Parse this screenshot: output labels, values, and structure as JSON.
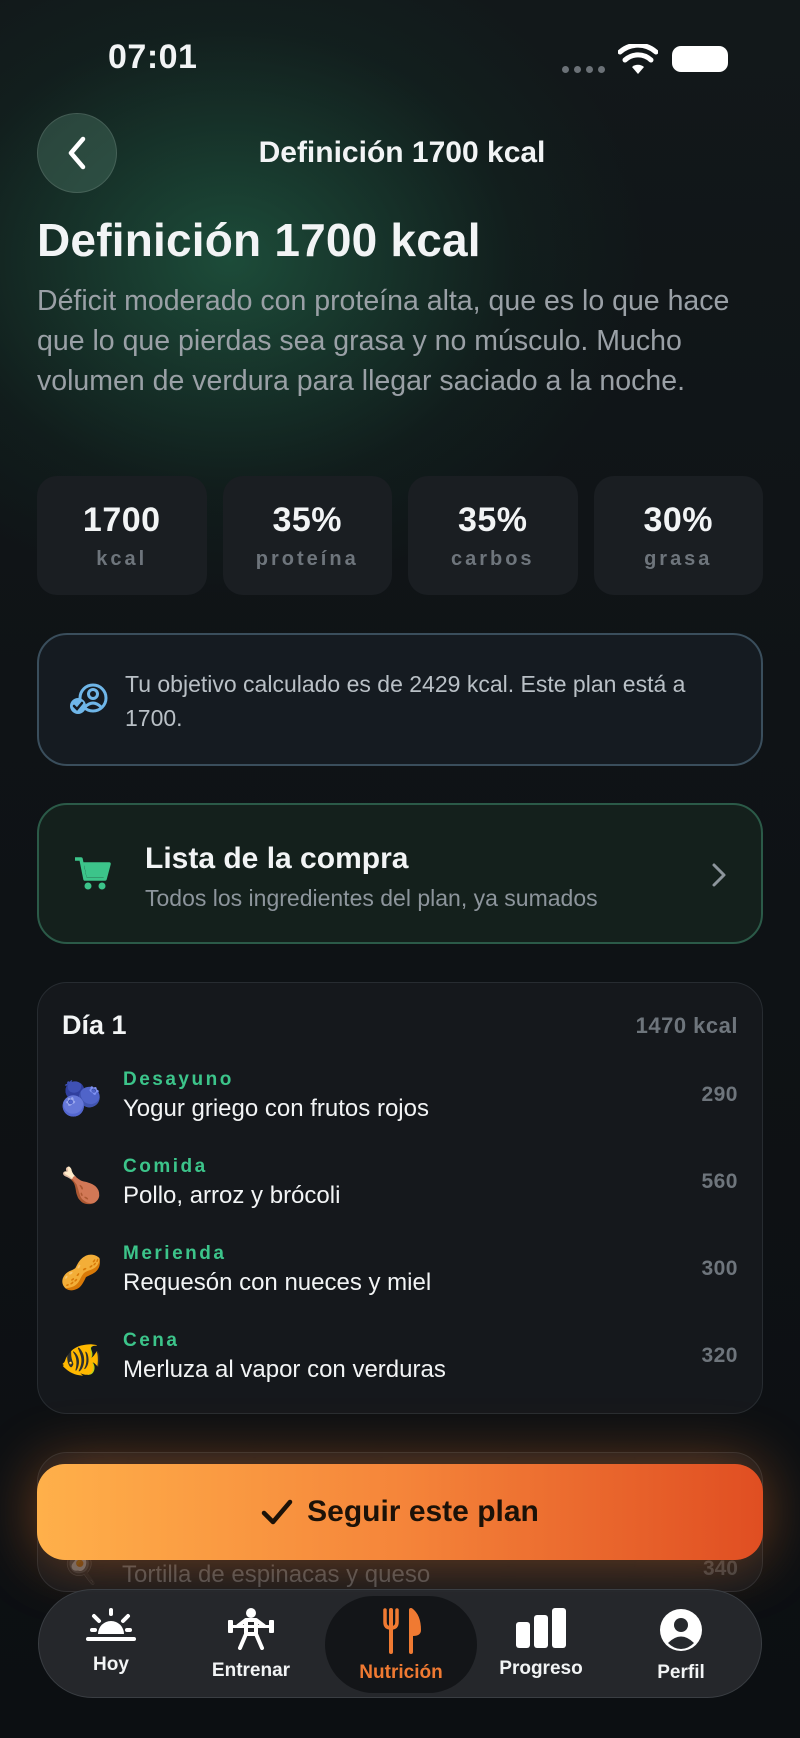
{
  "status_bar": {
    "time": "07:01"
  },
  "header": {
    "title": "Definición 1700 kcal"
  },
  "plan": {
    "title": "Definición 1700 kcal",
    "description": "Déficit moderado con proteína alta, que es lo que hace que lo que pierdas sea grasa y no músculo. Mucho volumen de verdura para llegar saciado a la noche.",
    "stats": [
      {
        "value": "1700",
        "label": "kcal"
      },
      {
        "value": "35%",
        "label": "proteína"
      },
      {
        "value": "35%",
        "label": "carbos"
      },
      {
        "value": "30%",
        "label": "grasa"
      }
    ]
  },
  "info": {
    "text": "Tu objetivo calculado es de 2429 kcal. Este plan está a 1700."
  },
  "shopping_list": {
    "title": "Lista de la compra",
    "subtitle": "Todos los ingredientes del plan, ya sumados"
  },
  "day": {
    "title": "Día 1",
    "total_kcal": "1470 kcal",
    "meals": [
      {
        "type": "Desayuno",
        "name": "Yogur griego con frutos rojos",
        "kcal": "290",
        "icon": "blueberries-icon",
        "emoji": "🫐"
      },
      {
        "type": "Comida",
        "name": "Pollo, arroz y brócoli",
        "kcal": "560",
        "icon": "chicken-leg-icon",
        "emoji": "🍗"
      },
      {
        "type": "Merienda",
        "name": "Requesón con nueces y miel",
        "kcal": "300",
        "icon": "peanuts-icon",
        "emoji": "🥜"
      },
      {
        "type": "Cena",
        "name": "Merluza al vapor con verduras",
        "kcal": "320",
        "icon": "fish-icon",
        "emoji": "🐠"
      }
    ]
  },
  "next_card": {
    "name": "Tortilla de espinacas y queso",
    "kcal": "340"
  },
  "cta": {
    "label": "Seguir este plan"
  },
  "tabbar": {
    "tabs": [
      {
        "label": "Hoy",
        "icon": "sunrise-icon"
      },
      {
        "label": "Entrenar",
        "icon": "weightlifter-icon"
      },
      {
        "label": "Nutrición",
        "icon": "fork-knife-icon",
        "active": true
      },
      {
        "label": "Progreso",
        "icon": "bar-chart-icon"
      },
      {
        "label": "Perfil",
        "icon": "profile-icon"
      }
    ]
  },
  "colors": {
    "accent_green": "#3cc48a",
    "accent_orange": "#f07a32",
    "info_border": "#3a4e5c",
    "shop_border": "#2b5a48"
  }
}
